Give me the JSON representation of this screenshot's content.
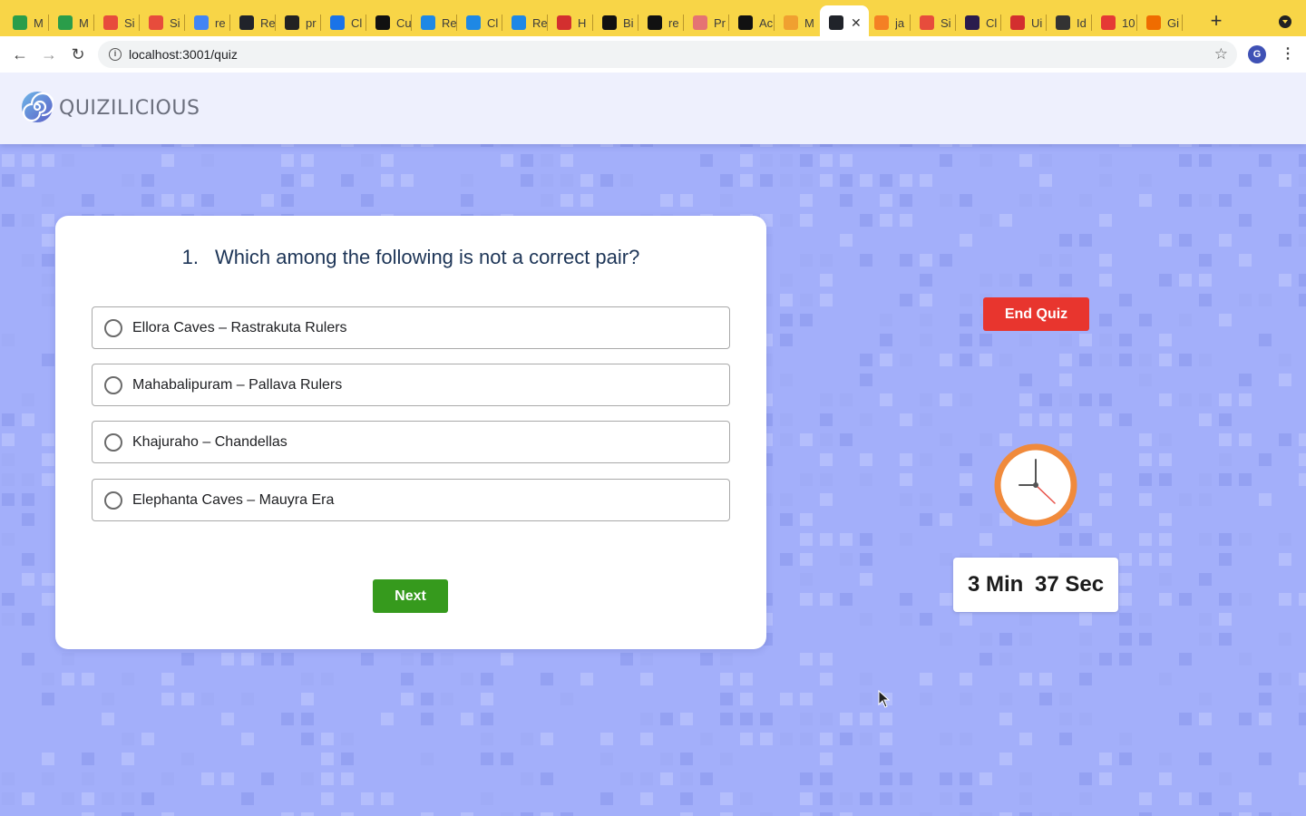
{
  "browser": {
    "tabs": [
      {
        "label": "M",
        "favicon": "gmail-icon",
        "color": "#2a9d4a"
      },
      {
        "label": "M",
        "favicon": "gmail-icon",
        "color": "#2a9d4a"
      },
      {
        "label": "Si",
        "favicon": "microsoft-icon",
        "color": "#e74c3c"
      },
      {
        "label": "Si",
        "favicon": "microsoft-icon",
        "color": "#e74c3c"
      },
      {
        "label": "re",
        "favicon": "google-icon",
        "color": "#4285f4"
      },
      {
        "label": "Re",
        "favicon": "react-icon",
        "color": "#20232a"
      },
      {
        "label": "pr",
        "favicon": "github-icon",
        "color": "#222222"
      },
      {
        "label": "Cl",
        "favicon": "share-icon",
        "color": "#1a73e8"
      },
      {
        "label": "Cu",
        "favicon": "circle-icon",
        "color": "#111111"
      },
      {
        "label": "Re",
        "favicon": "mui-icon",
        "color": "#1e88e5"
      },
      {
        "label": "Cl",
        "favicon": "mui-icon",
        "color": "#1e88e5"
      },
      {
        "label": "Re",
        "favicon": "mui-icon",
        "color": "#1e88e5"
      },
      {
        "label": "H",
        "favicon": "record-icon",
        "color": "#d32f2f"
      },
      {
        "label": "Bi",
        "favicon": "circle-icon",
        "color": "#111111"
      },
      {
        "label": "re",
        "favicon": "codesandbox-icon",
        "color": "#111111"
      },
      {
        "label": "Pr",
        "favicon": "pr-icon",
        "color": "#e57373"
      },
      {
        "label": "Ac",
        "favicon": "circle-icon",
        "color": "#111111"
      },
      {
        "label": "M",
        "favicon": "quiz-icon",
        "color": "#f0a030"
      },
      {
        "label": "",
        "favicon": "react-icon",
        "color": "#20232a",
        "active": true
      },
      {
        "label": "ja",
        "favicon": "stackoverflow-icon",
        "color": "#f48024"
      },
      {
        "label": "Si",
        "favicon": "microsoft-icon",
        "color": "#e74c3c"
      },
      {
        "label": "Cl",
        "favicon": "circle-icon",
        "color": "#2a1b4d"
      },
      {
        "label": "Ui",
        "favicon": "asterisk-icon",
        "color": "#d32f2f"
      },
      {
        "label": "Id",
        "favicon": "idea-icon",
        "color": "#333333"
      },
      {
        "label": "10",
        "favicon": "arc-icon",
        "color": "#e53935"
      },
      {
        "label": "Gi",
        "favicon": "arc-icon",
        "color": "#ef6c00"
      }
    ],
    "url": "localhost:3001/quiz",
    "profile_initial": "G"
  },
  "app": {
    "brand": "QUIZILICIOUS",
    "question": {
      "number": "1.",
      "text": "Which among the following is not a correct pair?"
    },
    "options": [
      "Ellora Caves – Rastrakuta Rulers",
      "Mahabalipuram – Pallava Rulers",
      "Khajuraho – Chandellas",
      "Elephanta Caves – Mauyra Era"
    ],
    "next_label": "Next",
    "end_label": "End Quiz",
    "timer": {
      "minutes": "3 Min",
      "seconds": "37 Sec"
    },
    "colors": {
      "accent_green": "#369a1d",
      "danger_red": "#e8352e",
      "clock_orange": "#f08a3c",
      "background": "#adb9fb"
    }
  }
}
